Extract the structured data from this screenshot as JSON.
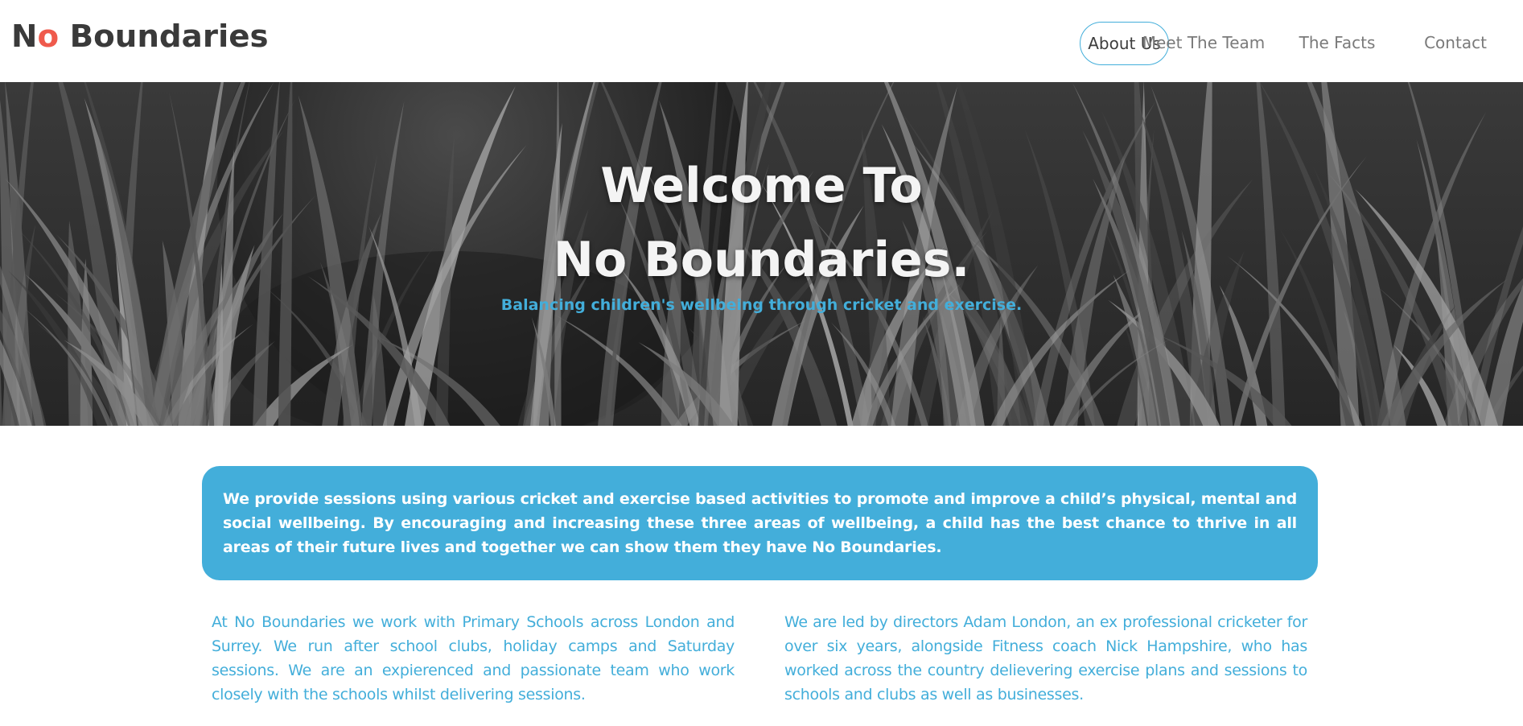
{
  "brand": {
    "logo_part1": "N",
    "logo_o": "o",
    "logo_part2": " Boundaries",
    "accent_color": "#43aeda",
    "logo_o_color": "#ef5a4c"
  },
  "nav": {
    "items": [
      {
        "label": "About Us",
        "active": true
      },
      {
        "label": "Meet The Team",
        "active": false
      },
      {
        "label": "The Facts",
        "active": false
      },
      {
        "label": "Contact",
        "active": false
      }
    ]
  },
  "hero": {
    "title_line1": "Welcome To",
    "title_line2": "No Boundaries.",
    "subtitle": "Balancing children's wellbeing through cricket and exercise."
  },
  "intro": {
    "text": "We provide sessions using various cricket and exercise based activities to promote and improve a child’s physical, mental and social wellbeing. By encouraging and increasing these three areas of wellbeing, a child has the best chance to thrive in all areas of their future lives and together we can show them they have No Boundaries."
  },
  "columns": {
    "left": "At No Boundaries we work with Primary Schools across London and Surrey. We run after school clubs, holiday camps and Saturday sessions. We are an expierenced and passionate team who work closely with the schools whilst delivering sessions.",
    "right": "We are led by directors Adam London, an ex professional cricketer for over six years, alongside Fitness coach Nick Hampshire, who has worked across the country delievering exercise plans and sessions to schools and clubs as well as businesses."
  }
}
